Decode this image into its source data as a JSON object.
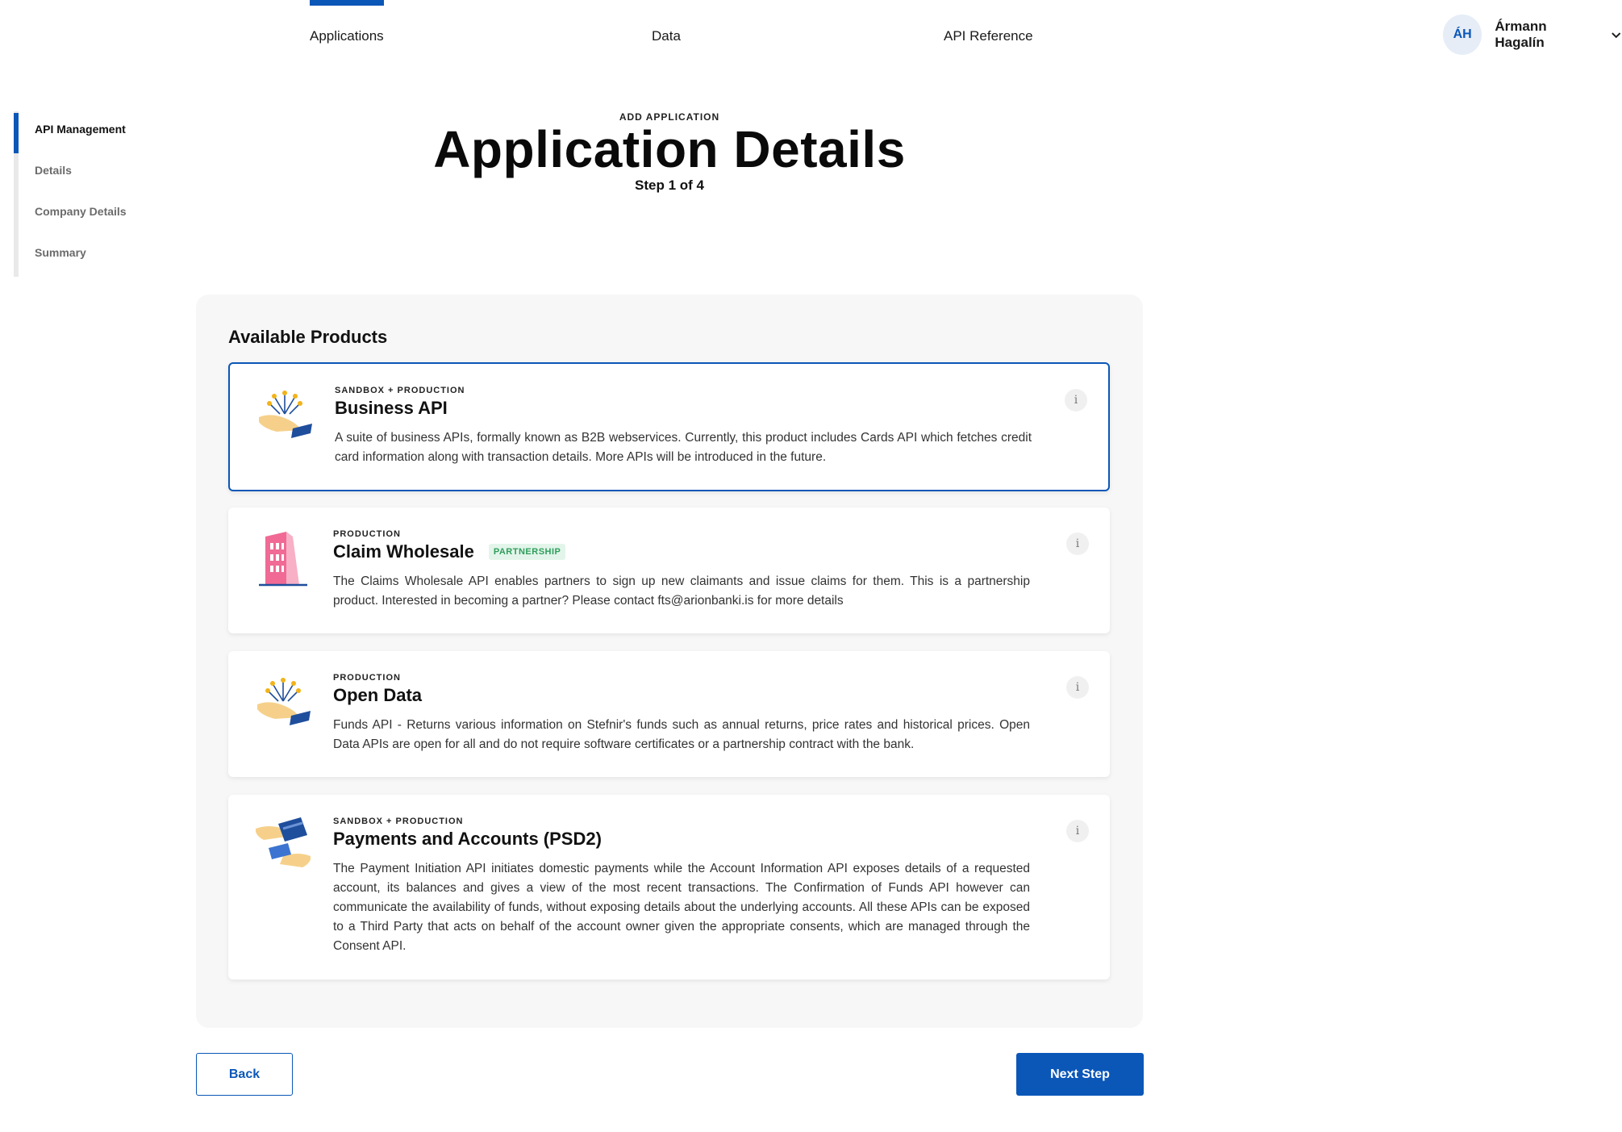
{
  "topnav": {
    "tabs": [
      {
        "label": "Applications",
        "active": true
      },
      {
        "label": "Data",
        "active": false
      },
      {
        "label": "API Reference",
        "active": false
      }
    ],
    "user": {
      "initials": "ÁH",
      "name": "Ármann Hagalín",
      "menu_icon": "chevron-down-icon"
    }
  },
  "sidebar": {
    "items": [
      {
        "label": "API Management",
        "active": true
      },
      {
        "label": "Details",
        "active": false
      },
      {
        "label": "Company Details",
        "active": false
      },
      {
        "label": "Summary",
        "active": false
      }
    ]
  },
  "header": {
    "eyebrow": "ADD APPLICATION",
    "title": "Application Details",
    "step": "Step 1 of 4"
  },
  "products": {
    "title": "Available Products",
    "items": [
      {
        "tier": "SANDBOX + PRODUCTION",
        "name": "Business API",
        "badge": "",
        "selected": true,
        "icon": "hand-network-icon",
        "description": "A suite of business APIs, formally known as B2B webservices. Currently, this product includes Cards API which fetches credit card information along with transaction details. More APIs will be introduced in the future."
      },
      {
        "tier": "PRODUCTION",
        "name": "Claim Wholesale",
        "badge": "PARTNERSHIP",
        "selected": false,
        "icon": "building-icon",
        "description": "The Claims Wholesale API enables partners to sign up new claimants and issue claims for them. This is a partnership product. Interested in becoming a partner? Please contact fts@arionbanki.is for more details"
      },
      {
        "tier": "PRODUCTION",
        "name": "Open Data",
        "badge": "",
        "selected": false,
        "icon": "hand-network-icon",
        "description": "Funds API - Returns various information on Stefnir's funds such as annual returns, price rates and historical prices. Open Data APIs are open for all and do not require software certificates or a partnership contract with the bank."
      },
      {
        "tier": "SANDBOX + PRODUCTION",
        "name": "Payments and Accounts (PSD2)",
        "badge": "",
        "selected": false,
        "icon": "hands-exchange-card-icon",
        "description": "The Payment Initiation API initiates domestic payments while the Account Information API exposes details of a requested account, its balances and gives a view of the most recent transactions. The Confirmation of Funds API however can communicate the availability of funds, without exposing details about the underlying accounts. All these APIs can be exposed to a Third Party that acts on behalf of the account owner given the appropriate consents, which are managed through the Consent API."
      }
    ],
    "info_glyph": "i"
  },
  "actions": {
    "back_label": "Back",
    "next_label": "Next Step"
  },
  "colors": {
    "primary": "#0b57b8",
    "badge_green": "#2e9e5b",
    "panel_bg": "#f7f7f7"
  }
}
